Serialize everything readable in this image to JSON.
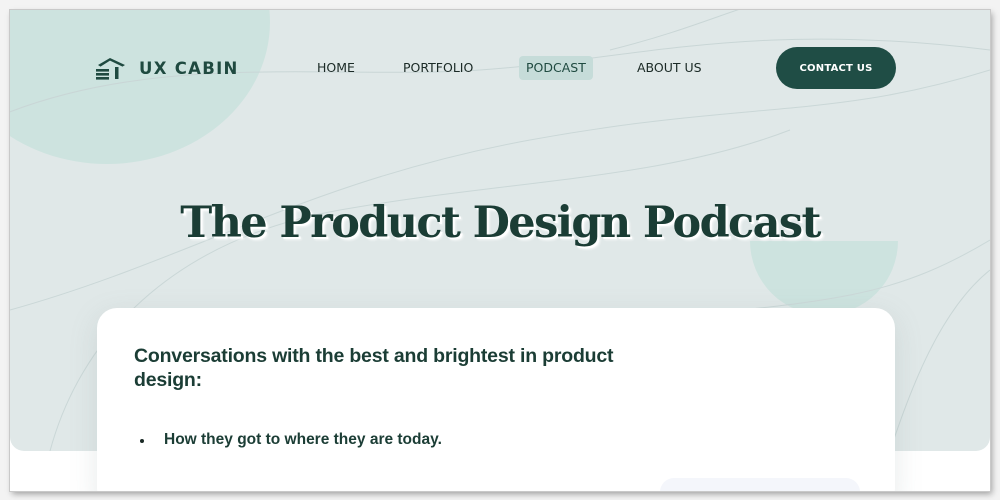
{
  "brand": {
    "name": "UX CABIN",
    "icon": "house-logo-icon"
  },
  "nav": {
    "items": [
      {
        "label": "HOME",
        "active": false
      },
      {
        "label": "PORTFOLIO",
        "active": false
      },
      {
        "label": "PODCAST",
        "active": true
      },
      {
        "label": "ABOUT US",
        "active": false
      }
    ],
    "contact_label": "CONTACT US"
  },
  "hero": {
    "title": "The Product Design Podcast"
  },
  "card": {
    "heading": "Conversations with the best and brightest in product design:",
    "bullets": [
      "How they got to where they are today."
    ]
  },
  "colors": {
    "brand_dark_green": "#1f4d45",
    "hero_background": "#e0e8e8",
    "accent_mint": "#cde3df",
    "active_nav": "#c6dcd9"
  }
}
